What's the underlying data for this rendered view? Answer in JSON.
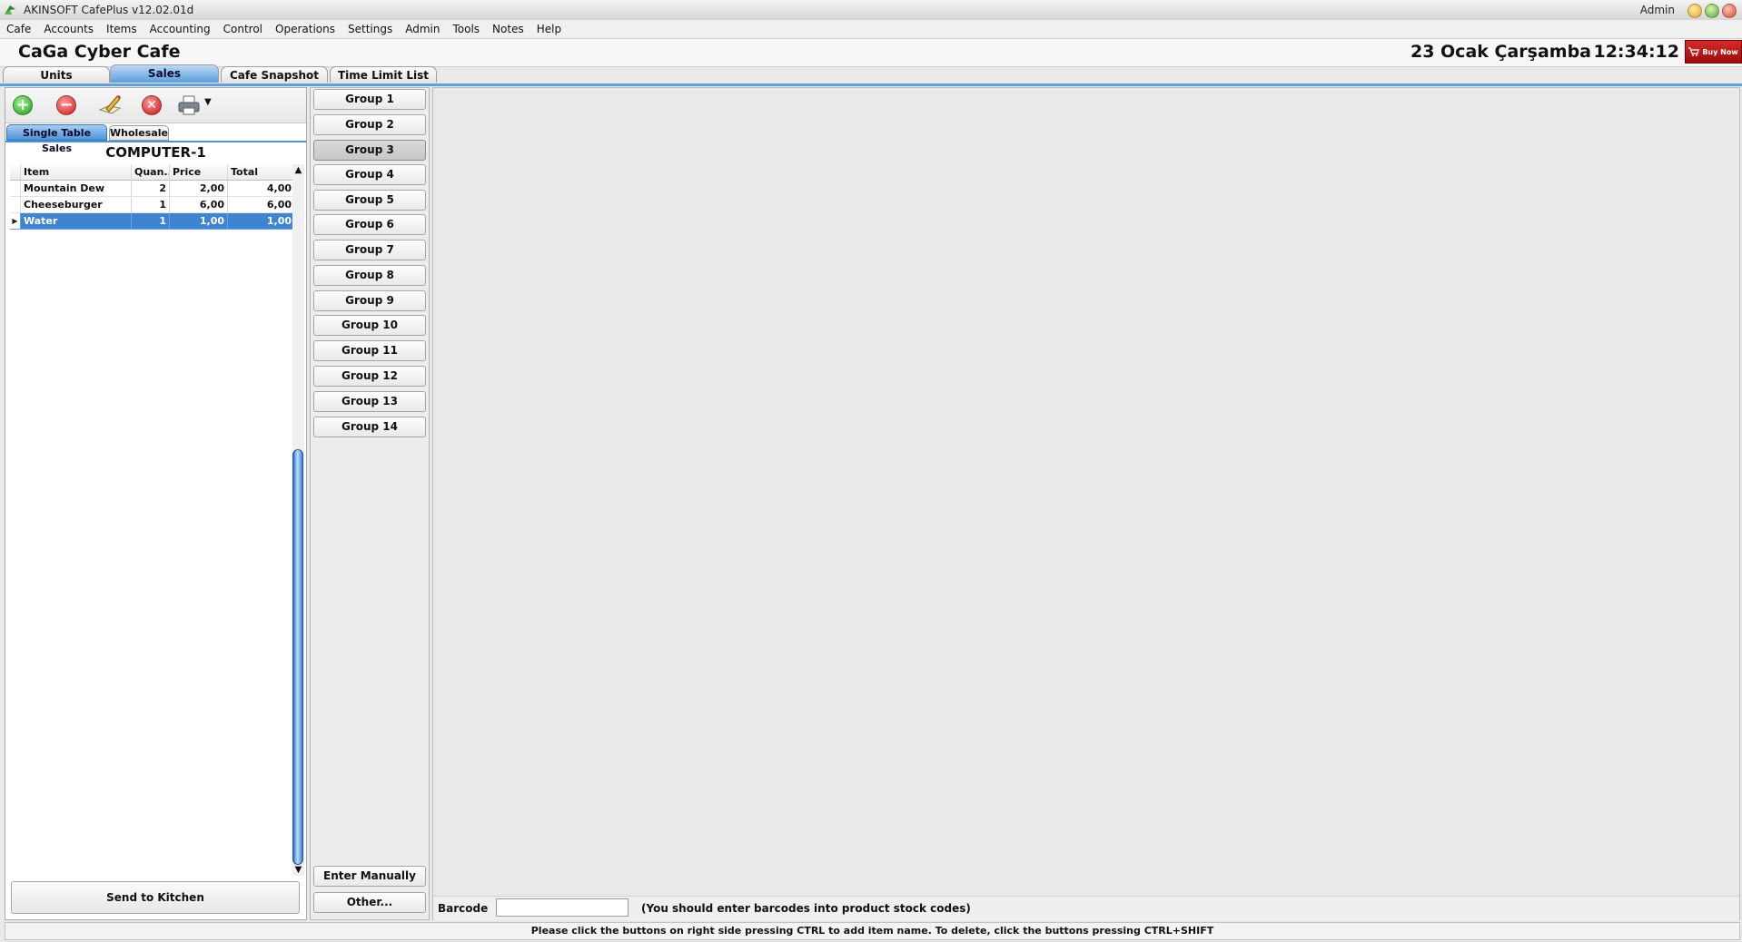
{
  "window": {
    "title": "AKINSOFT CafePlus v12.02.01d",
    "user": "Admin"
  },
  "menu": [
    "Cafe",
    "Accounts",
    "Items",
    "Accounting",
    "Control",
    "Operations",
    "Settings",
    "Admin",
    "Tools",
    "Notes",
    "Help"
  ],
  "header": {
    "cafe_name": "CaGa Cyber Cafe",
    "date": "23 Ocak Çarşamba",
    "time": "12:34:12",
    "buy_now": "Buy Now"
  },
  "tabs": [
    "Units",
    "Sales",
    "Cafe Snapshot",
    "Time Limit List"
  ],
  "active_tab": "Sales",
  "sales": {
    "subtabs": [
      "Single Table Sales",
      "Wholesale"
    ],
    "computer": "COMPUTER-1",
    "columns": [
      "Item",
      "Quan...",
      "Price",
      "Total"
    ],
    "rows": [
      {
        "item": "Mountain Dew",
        "qty": "2",
        "price": "2,00",
        "total": "4,00"
      },
      {
        "item": "Cheeseburger",
        "qty": "1",
        "price": "6,00",
        "total": "6,00"
      },
      {
        "item": "Water",
        "qty": "1",
        "price": "1,00",
        "total": "1,00"
      }
    ],
    "selected_row": 2,
    "send_to_kitchen": "Send to Kitchen"
  },
  "groups": [
    "Group 1",
    "Group 2",
    "Group 3",
    "Group 4",
    "Group 5",
    "Group 6",
    "Group 7",
    "Group 8",
    "Group 9",
    "Group 10",
    "Group 11",
    "Group 12",
    "Group 13",
    "Group 14"
  ],
  "pressed_group": 2,
  "group_actions": {
    "enter_manually": "Enter Manually",
    "other": "Other..."
  },
  "barcode": {
    "label": "Barcode",
    "value": "",
    "hint": "(You should enter barcodes into product stock codes)"
  },
  "status": "Please click the buttons on right side pressing CTRL to add item name. To delete, click the buttons pressing CTRL+SHIFT",
  "colors": {
    "accent": "#5fa2de",
    "selection": "#3f84d2",
    "buy_now": "#c41a1a"
  }
}
